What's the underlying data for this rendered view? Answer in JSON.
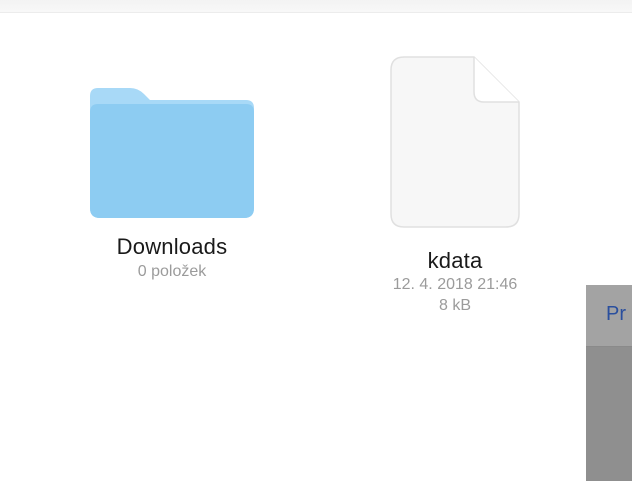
{
  "items": [
    {
      "name": "Downloads",
      "detail": "0 položek",
      "icon": "folder-icon",
      "icon_color": "#8dccf2"
    },
    {
      "name": "kdata",
      "date": "12. 4. 2018 21:46",
      "size": "8 kB",
      "icon": "document-icon",
      "icon_color": "#f7f7f7"
    }
  ],
  "context_menu": {
    "first_item_label": "Pr"
  },
  "colors": {
    "menu_text": "#2a4f9e",
    "menu_background": "#8f8f8f"
  }
}
